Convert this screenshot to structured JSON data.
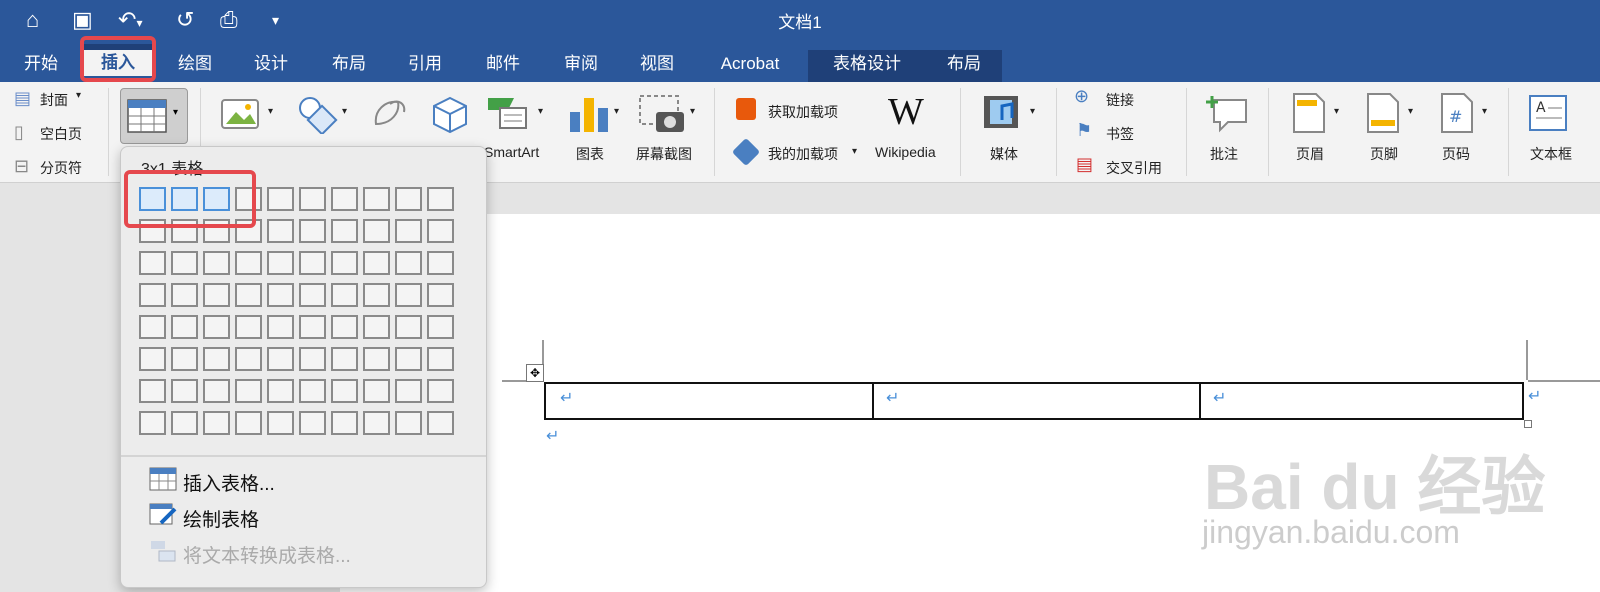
{
  "window": {
    "title": "文档1"
  },
  "quick_access": [
    {
      "icon": "home-icon"
    },
    {
      "icon": "save-icon"
    },
    {
      "icon": "undo-icon"
    },
    {
      "icon": "redo-icon"
    },
    {
      "icon": "print-icon"
    },
    {
      "icon": "customize-icon"
    }
  ],
  "tabs": [
    "开始",
    "插入",
    "绘图",
    "设计",
    "布局",
    "引用",
    "邮件",
    "审阅",
    "视图",
    "Acrobat",
    "表格设计",
    "布局"
  ],
  "active_tab": "插入",
  "ribbon": {
    "pages": {
      "cover": "封面",
      "blank": "空白页",
      "break": "分页符"
    },
    "smartart": "SmartArt",
    "chart": "图表",
    "screenshot": "屏幕截图",
    "get_addins": "获取加载项",
    "my_addins": "我的加载项",
    "wikipedia": "Wikipedia",
    "wikipedia_logo": "W",
    "media": "媒体",
    "links": {
      "link": "链接",
      "bookmark": "书签",
      "crossref": "交叉引用"
    },
    "comment": "批注",
    "header": "页眉",
    "footer": "页脚",
    "page_number": "页码",
    "textbox": "文本框"
  },
  "table_dropdown": {
    "header": "3x1 表格",
    "grid_cols": 10,
    "grid_rows": 8,
    "selected_cols": 3,
    "selected_rows": 1,
    "items": [
      {
        "label": "插入表格...",
        "enabled": true
      },
      {
        "label": "绘制表格",
        "enabled": true
      },
      {
        "label": "将文本转换成表格...",
        "enabled": false
      }
    ]
  },
  "document": {
    "paragraph_mark": "↵",
    "table_cells": 3
  },
  "watermark": {
    "logo": "Bai du 经验",
    "url": "jingyan.baidu.com"
  }
}
